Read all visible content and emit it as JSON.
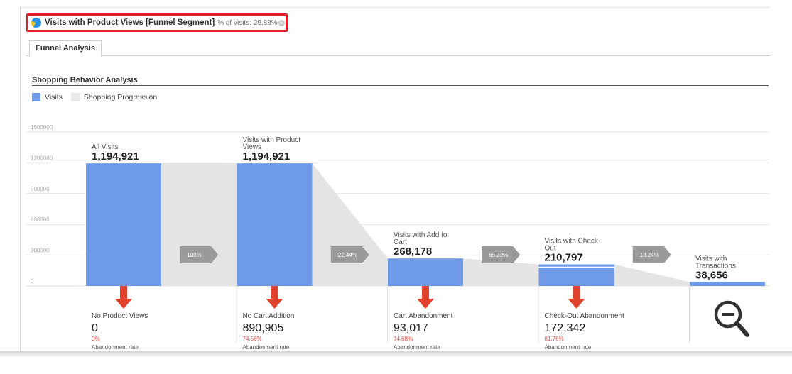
{
  "segment": {
    "name": "Visits with Product Views [Funnel Segment]",
    "pct_text": "% of visits: 29.88%"
  },
  "tabs": [
    {
      "label": "Funnel Analysis"
    }
  ],
  "section_title": "Shopping Behavior Analysis",
  "legend": [
    {
      "label": "Visits",
      "color": "#6e9ae8"
    },
    {
      "label": "Shopping Progression",
      "color": "#e8e8e8"
    }
  ],
  "colors": {
    "bar": "#6e9ae8",
    "progression": "#e4e4e4",
    "arrow": "#e0422e",
    "chevron": "#9a9a9a",
    "rate": "#e34a4a"
  },
  "chart_data": {
    "type": "bar",
    "ylim": [
      0,
      1500000
    ],
    "y_ticks": [
      {
        "value": 0,
        "label": "0"
      },
      {
        "value": 300000,
        "label": "300000"
      },
      {
        "value": 600000,
        "label": "600000"
      },
      {
        "value": 900000,
        "label": "900000"
      },
      {
        "value": 1200000,
        "label": "1200000"
      },
      {
        "value": 1500000,
        "label": "1500000"
      }
    ],
    "categories": [
      "All Visits",
      "Visits with Product Views",
      "Visits with Add to Cart",
      "Visits with Check-Out",
      "Visits with Transactions"
    ],
    "category_lines": [
      [
        "All Visits"
      ],
      [
        "Visits with Product",
        "Views"
      ],
      [
        "Visits with Add to",
        "Cart"
      ],
      [
        "Visits with Check-",
        "Out"
      ],
      [
        "Visits with",
        "Transactions"
      ]
    ],
    "values": [
      1194921,
      1194921,
      268178,
      210797,
      38656
    ],
    "value_labels": [
      "1,194,921",
      "1,194,921",
      "268,178",
      "210,797",
      "38,656"
    ],
    "progression": [
      "100%",
      "22.44%",
      "65.32%",
      "18.24%"
    ],
    "drop_offs": [
      {
        "label": "No Product Views",
        "value": "0",
        "rate": "0%",
        "rate_label": "Abandonment rate"
      },
      {
        "label": "No Cart Addition",
        "value": "890,905",
        "rate": "74.56%",
        "rate_label": "Abandonment rate"
      },
      {
        "label": "Cart Abandonment",
        "value": "93,017",
        "rate": "34.68%",
        "rate_label": "Abandonment rate"
      },
      {
        "label": "Check-Out Abandonment",
        "value": "172,342",
        "rate": "81.76%",
        "rate_label": "Abandonment rate"
      }
    ]
  }
}
